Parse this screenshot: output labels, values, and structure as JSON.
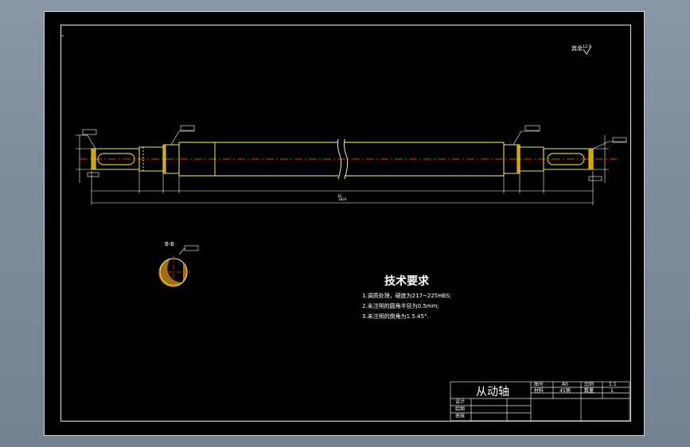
{
  "drawing": {
    "roughness_note": "其余",
    "roughness_value": "12.5",
    "section_label": "B-B",
    "total_length_dim": "1820",
    "mid_dim": "30",
    "tech_req": {
      "title": "技术要求",
      "items": [
        "1.调质处理，硬度为217~225HBS;",
        "2.未注明的圆角半径为0.5mm;",
        "3.未注明的倒角为1.5.45°."
      ]
    },
    "title_block": {
      "part_name": "从动轴",
      "figure_no_label": "图号",
      "figure_no": "A0",
      "scale_label": "比例",
      "scale": "1:1",
      "material_label": "材料",
      "material": "45钢",
      "quantity_label": "数量",
      "quantity": "1",
      "rows": [
        "设计",
        "绘图",
        "审核"
      ]
    },
    "colors": {
      "background": "#000000",
      "outline": "#ffff66",
      "centerline": "#ff2a2a",
      "annotation": "#ffffff",
      "cyan": "#66e0ff"
    }
  }
}
